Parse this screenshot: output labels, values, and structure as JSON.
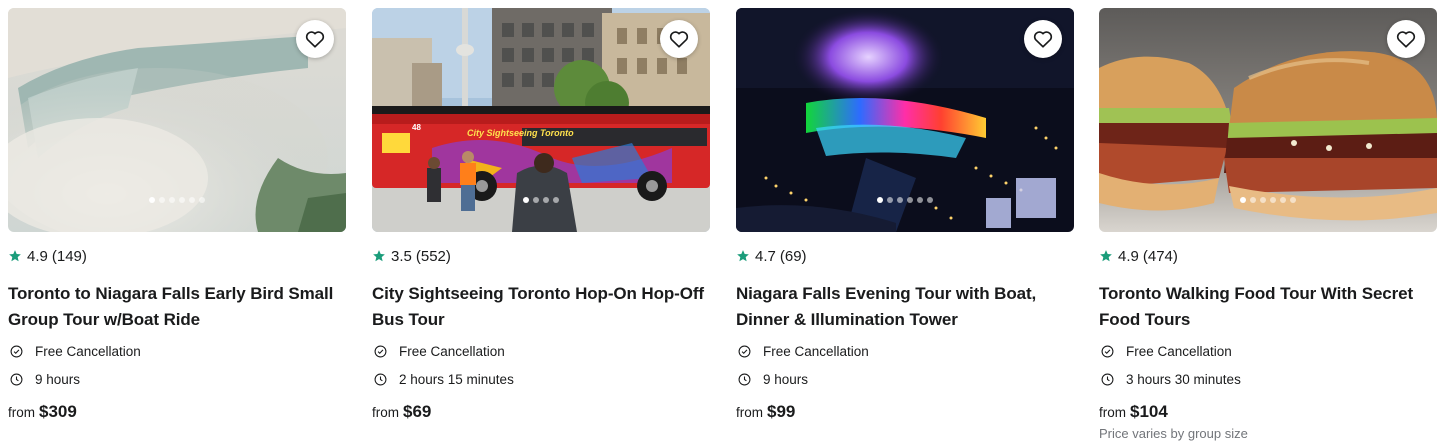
{
  "cards": [
    {
      "rating": "4.9",
      "review_count": "(149)",
      "title": "Toronto to Niagara Falls Early Bird Small Group Tour w/Boat Ride",
      "cancellation": "Free Cancellation",
      "duration": "9 hours",
      "price_prefix": "from",
      "price": "$309",
      "photo_dots": 6,
      "photo_active_dot": 1,
      "image": "niagara-falls-mist"
    },
    {
      "rating": "3.5",
      "review_count": "(552)",
      "title": "City Sightseeing Toronto Hop-On Hop-Off Bus Tour",
      "cancellation": "Free Cancellation",
      "duration": "2 hours 15 minutes",
      "price_prefix": "from",
      "price": "$69",
      "photo_dots": 4,
      "photo_active_dot": 1,
      "image": "red-double-decker-bus",
      "bus_sign": "City Sightseeing Toronto",
      "bus_number": "48"
    },
    {
      "rating": "4.7",
      "review_count": "(69)",
      "title": "Niagara Falls Evening Tour with Boat, Dinner & Illumination Tower",
      "cancellation": "Free Cancellation",
      "duration": "9 hours",
      "price_prefix": "from",
      "price": "$99",
      "photo_dots": 6,
      "photo_active_dot": 1,
      "image": "illuminated-falls-night"
    },
    {
      "rating": "4.9",
      "review_count": "(474)",
      "title": "Toronto Walking Food Tour With Secret Food Tours",
      "cancellation": "Free Cancellation",
      "duration": "3 hours 30 minutes",
      "price_prefix": "from",
      "price": "$104",
      "price_note": "Price varies by group size",
      "photo_dots": 6,
      "photo_active_dot": 1,
      "image": "peameal-bacon-sandwich"
    }
  ],
  "icons": {
    "rating": "star-icon",
    "cancellation": "check-circle-icon",
    "duration": "clock-icon",
    "wishlist": "heart-icon"
  },
  "colors": {
    "star": "#1b9d7b",
    "text": "#1a1b1c",
    "muted": "#72757a"
  }
}
